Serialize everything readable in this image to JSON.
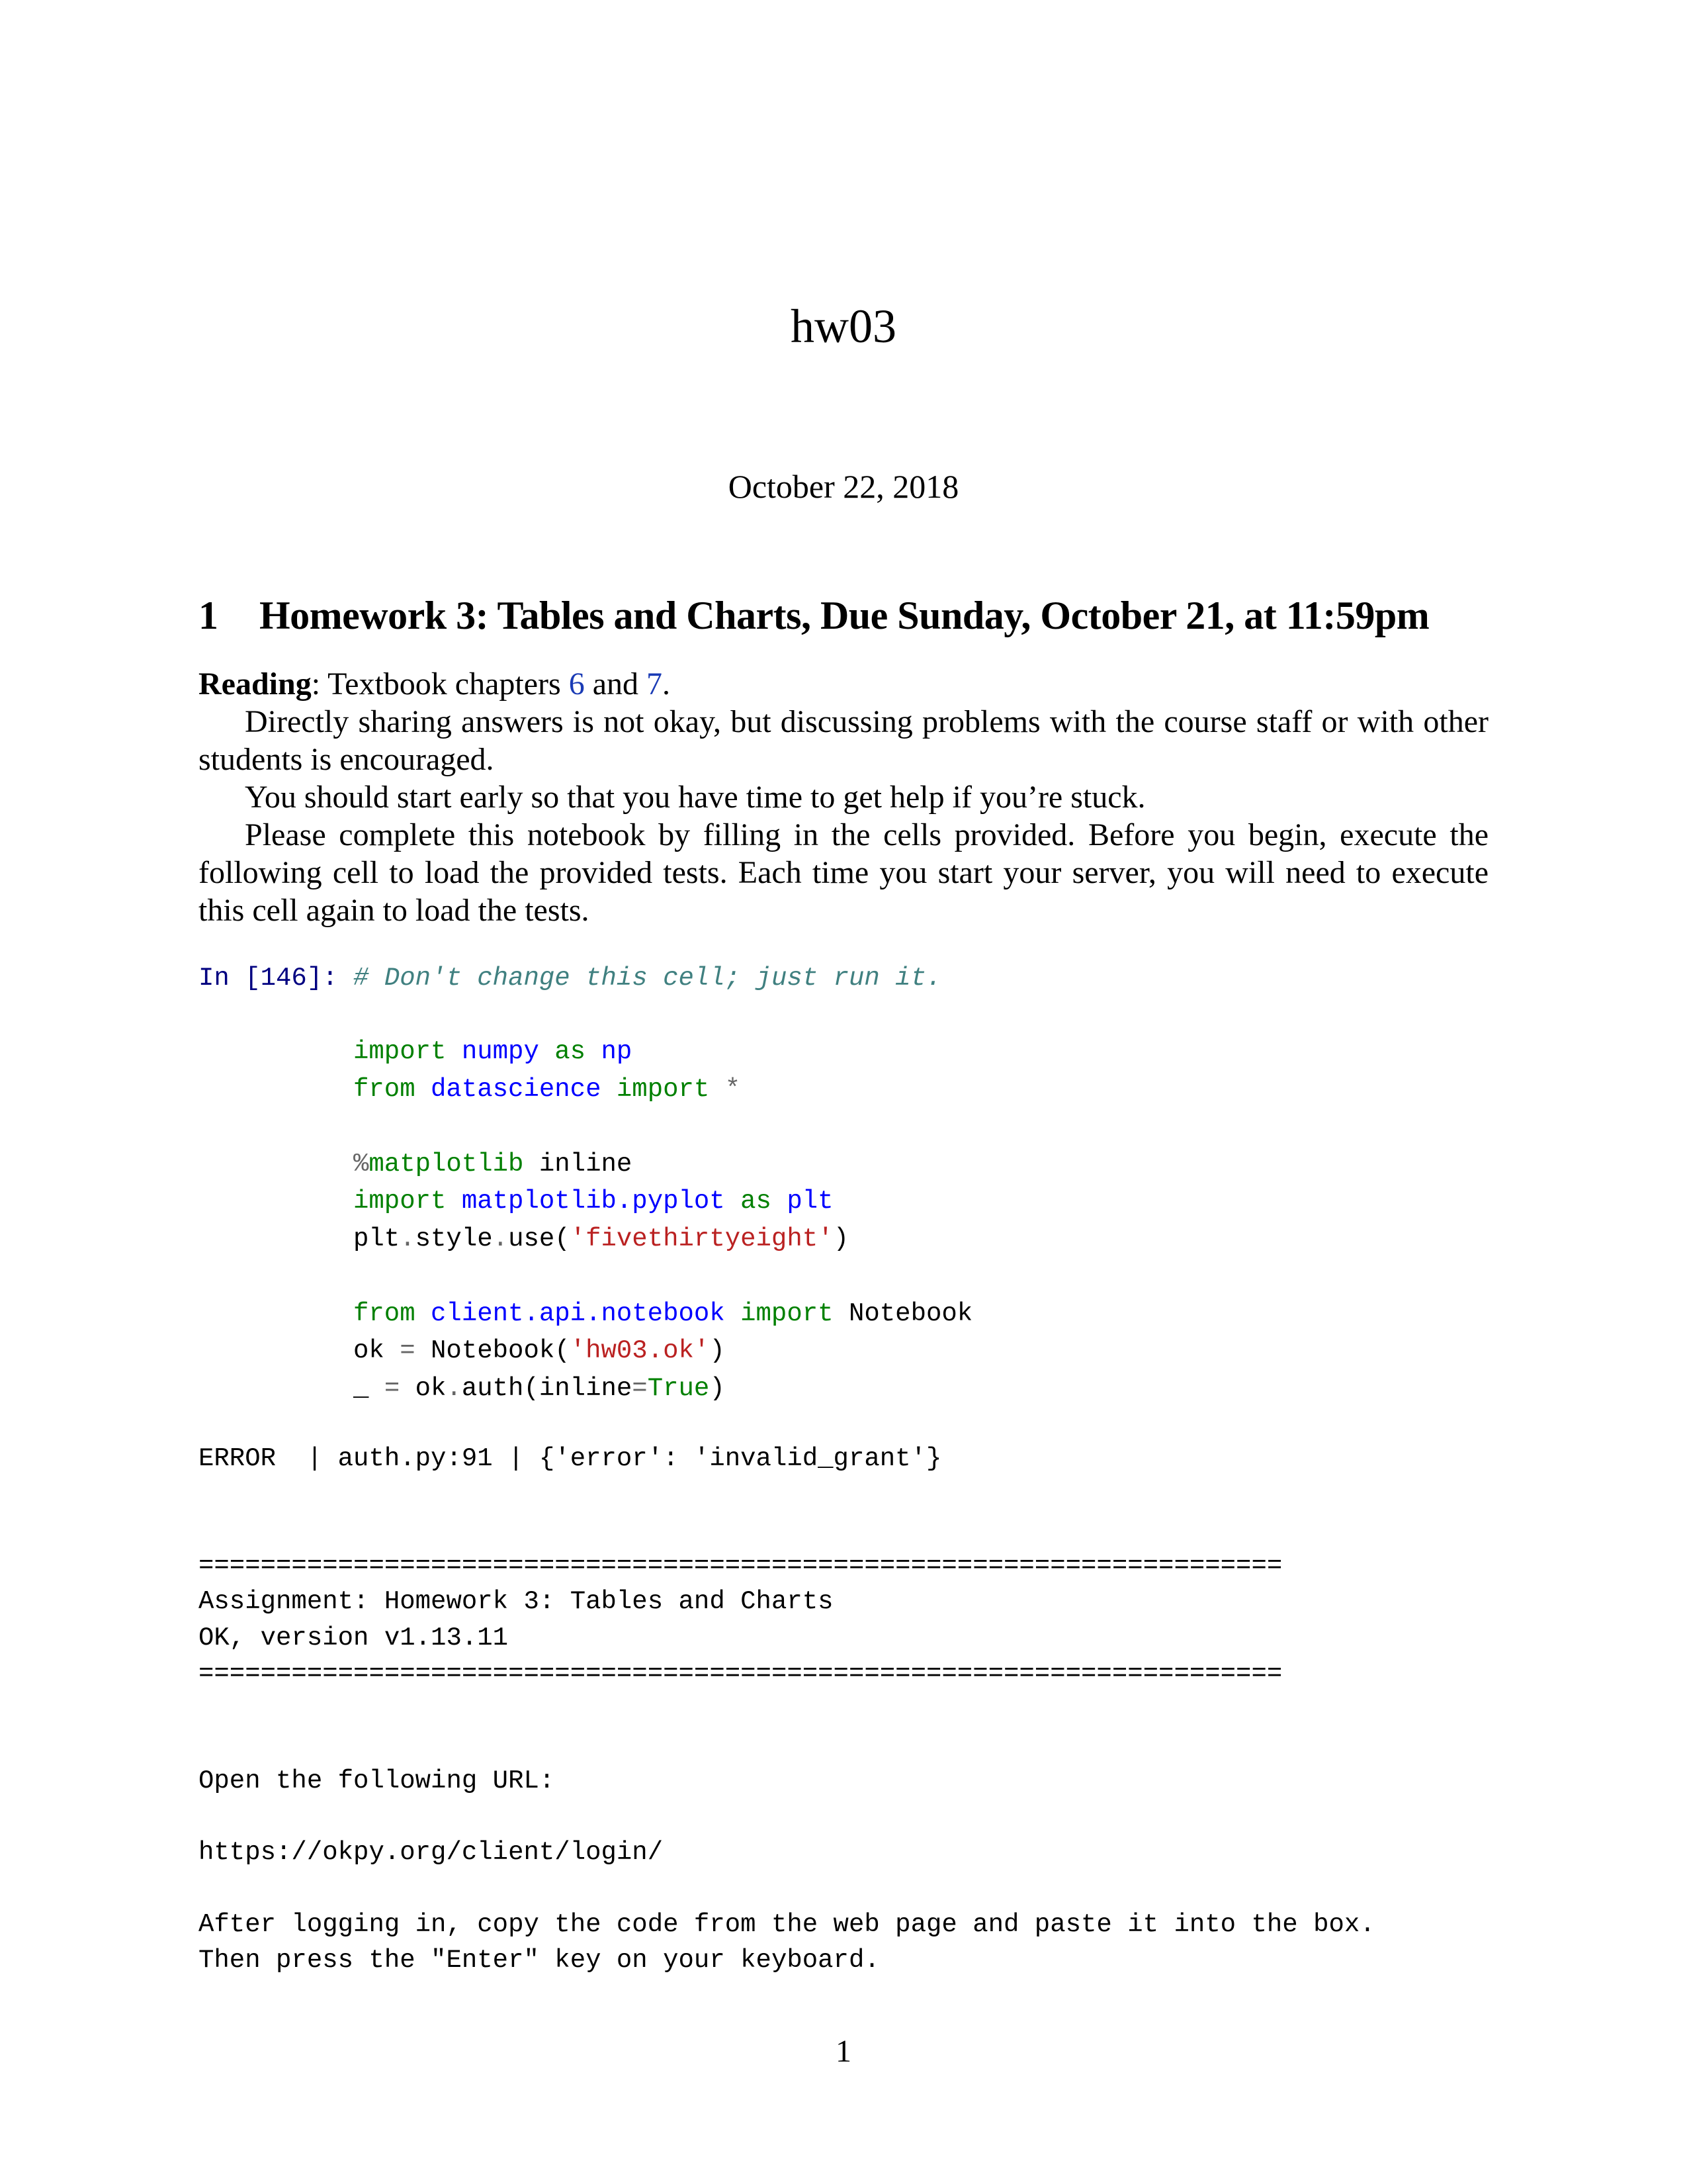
{
  "document": {
    "title": "hw03",
    "date": "October 22, 2018",
    "page_number": "1"
  },
  "section": {
    "number": "1",
    "title": "Homework 3: Tables and Charts, Due Sunday, October 21, at 11:59pm"
  },
  "intro": {
    "reading_label": "Reading",
    "reading_text_pre": ": Textbook chapters ",
    "chapter_link_1": "6",
    "reading_text_mid": " and ",
    "chapter_link_2": "7",
    "reading_text_post": ".",
    "paragraph_1": "Directly sharing answers is not okay, but discussing problems with the course staff or with other students is encouraged.",
    "paragraph_2": "You should start early so that you have time to get help if you’re stuck.",
    "paragraph_3": "Please complete this notebook by filling in the cells provided.  Before you begin, execute the following cell to load the provided tests. Each time you start your server, you will need to execute this cell again to load the tests."
  },
  "code_cell": {
    "prompt": "In [146]:",
    "comment": "# Don't change this cell; just run it.",
    "line_1": {
      "kw1": "import",
      "name1": "numpy",
      "kw2": "as",
      "name2": "np"
    },
    "line_2": {
      "kw1": "from",
      "name1": "datascience",
      "kw2": "import",
      "op": "*"
    },
    "line_3": {
      "op": "%",
      "kw": "matplotlib",
      "plain": "inline"
    },
    "line_4": {
      "kw1": "import",
      "name1": "matplotlib.pyplot",
      "kw2": "as",
      "name2": "plt"
    },
    "line_5": {
      "p1": "plt",
      "op1": ".",
      "p2": "style",
      "op2": ".",
      "p3": "use(",
      "str": "'fivethirtyeight'",
      "p4": ")"
    },
    "line_6": {
      "kw1": "from",
      "name1": "client.api.notebook",
      "kw2": "import",
      "plain": "Notebook"
    },
    "line_7": {
      "p1": "ok",
      "op": "=",
      "p2": "Notebook(",
      "str": "'hw03.ok'",
      "p3": ")"
    },
    "line_8": {
      "p1": "_",
      "op1": "=",
      "p2": "ok",
      "op2": ".",
      "p3": "auth(inline",
      "op3": "=",
      "kw": "True",
      "p4": ")"
    }
  },
  "output": {
    "error_line": "ERROR  | auth.py:91 | {'error': 'invalid_grant'}",
    "separator": "======================================================================",
    "assignment_line": "Assignment: Homework 3: Tables and Charts",
    "version_line": "OK, version v1.13.11",
    "open_url_line": "Open the following URL:",
    "url": "https://okpy.org/client/login/",
    "instruction_line_1": "After logging in, copy the code from the web page and paste it into the box.",
    "instruction_line_2": "Then press the \"Enter\" key on your keyboard."
  },
  "colors": {
    "link": "#1a3bb5",
    "prompt": "#000080",
    "comment": "#408080",
    "keyword": "#008000",
    "name": "#0000ff",
    "string": "#ba2121",
    "operator": "#666666"
  }
}
